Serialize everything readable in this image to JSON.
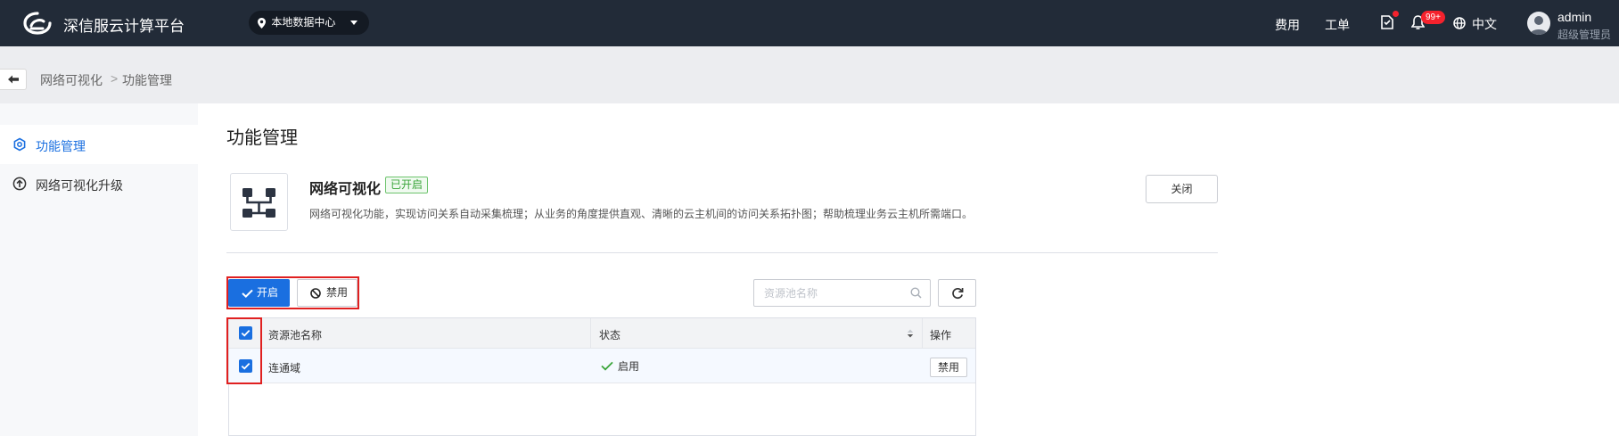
{
  "header": {
    "brand": "深信服云计算平台",
    "datacenter": "本地数据中心",
    "nav": [
      "费用",
      "工单"
    ],
    "notification_count": "99+",
    "language": "中文",
    "user": {
      "name": "admin",
      "role": "超级管理员"
    }
  },
  "breadcrumb": {
    "items": [
      "网络可视化",
      "功能管理"
    ],
    "separator": ">"
  },
  "sidebar": {
    "items": [
      {
        "label": "功能管理",
        "icon": "hexagon-icon",
        "active": true
      },
      {
        "label": "网络可视化升级",
        "icon": "upgrade-icon",
        "active": false
      }
    ]
  },
  "page": {
    "title": "功能管理",
    "feature": {
      "name": "网络可视化",
      "status_tag": "已开启",
      "description": "网络可视化功能，实现访问关系自动采集梳理；从业务的角度提供直观、清晰的云主机间的访问关系拓扑图；帮助梳理业务云主机所需端口。",
      "close_label": "关闭"
    },
    "toolbar": {
      "enable_label": "开启",
      "disable_label": "禁用",
      "search_placeholder": "资源池名称"
    },
    "table": {
      "columns": [
        "资源池名称",
        "状态",
        "操作"
      ],
      "rows": [
        {
          "name": "连通域",
          "status": "启用",
          "action": "禁用",
          "checked": true
        }
      ]
    }
  },
  "colors": {
    "topbar": "#222b38",
    "primary": "#1a6fe0",
    "success": "#3aa53a",
    "danger": "#e02020"
  }
}
